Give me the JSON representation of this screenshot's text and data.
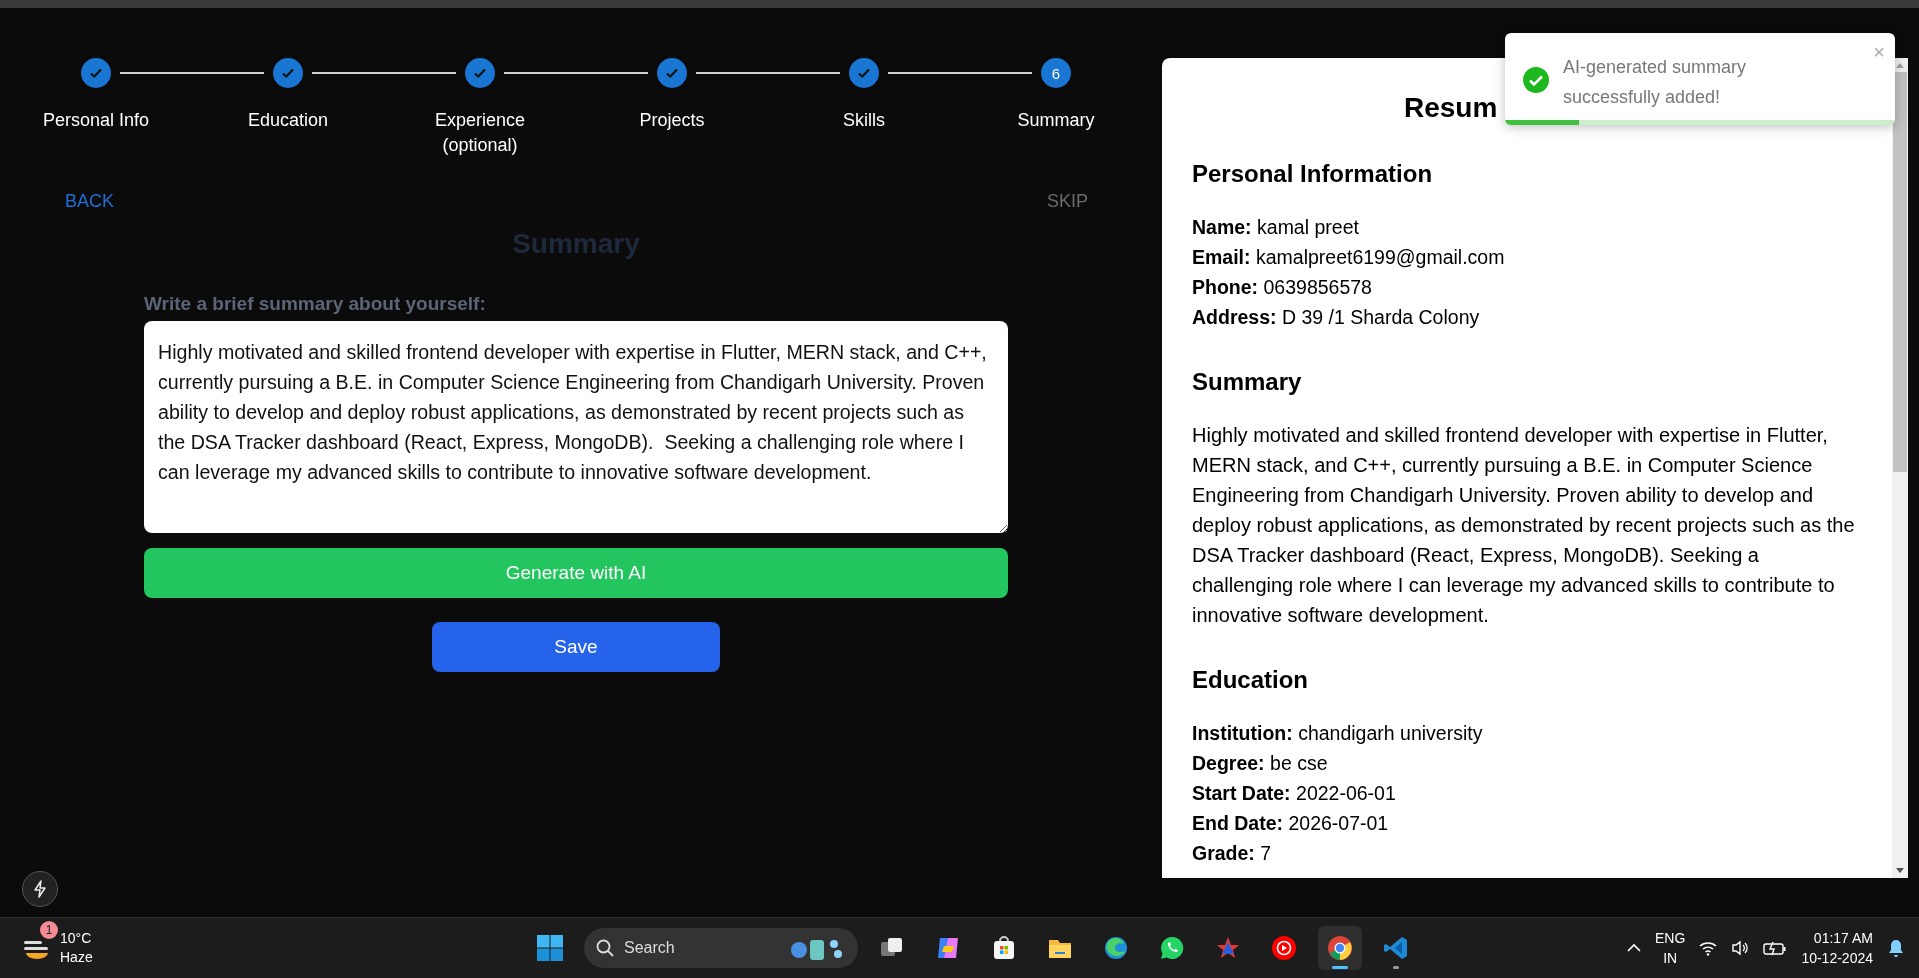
{
  "stepper": {
    "steps": [
      {
        "label": "Personal Info",
        "done": true
      },
      {
        "label": "Education",
        "done": true
      },
      {
        "label": "Experience (optional)",
        "done": true
      },
      {
        "label": "Projects",
        "done": true
      },
      {
        "label": "Skills",
        "done": true
      },
      {
        "label": "Summary",
        "done": false,
        "number": "6"
      }
    ]
  },
  "nav": {
    "back": "BACK",
    "skip": "SKIP"
  },
  "form": {
    "heading": "Summary",
    "label": "Write a brief summary about yourself:",
    "value": "Highly motivated and skilled frontend developer with expertise in Flutter, MERN stack, and C++, currently pursuing a B.E. in Computer Science Engineering from Chandigarh University. Proven ability to develop and deploy robust applications, as demonstrated by recent projects such as the DSA Tracker dashboard (React, Express, MongoDB).  Seeking a challenging role where I can leverage my advanced skills to contribute to innovative software development.",
    "generate_button": "Generate with AI",
    "save_button": "Save"
  },
  "resume": {
    "title": "Resum",
    "sections": [
      {
        "kind": "fields",
        "heading": "Personal Information",
        "rows": [
          {
            "label": "Name:",
            "value": "kamal preet"
          },
          {
            "label": "Email:",
            "value": "kamalpreet6199@gmail.com"
          },
          {
            "label": "Phone:",
            "value": "0639856578"
          },
          {
            "label": "Address:",
            "value": "D 39 /1 Sharda Colony"
          }
        ]
      },
      {
        "kind": "paragraph",
        "heading": "Summary",
        "text": "Highly motivated and skilled frontend developer with expertise in Flutter, MERN stack, and C++, currently pursuing a B.E. in Computer Science Engineering from Chandigarh University. Proven ability to develop and deploy robust applications, as demonstrated by recent projects such as the DSA Tracker dashboard (React, Express, MongoDB). Seeking a challenging role where I can leverage my advanced skills to contribute to innovative software development."
      },
      {
        "kind": "fields",
        "heading": "Education",
        "rows": [
          {
            "label": "Institution:",
            "value": "chandigarh university"
          },
          {
            "label": "Degree:",
            "value": "be cse"
          },
          {
            "label": "Start Date:",
            "value": "2022-06-01"
          },
          {
            "label": "End Date:",
            "value": "2026-07-01"
          },
          {
            "label": "Grade:",
            "value": "7"
          }
        ]
      }
    ]
  },
  "toast": {
    "message": "AI-generated summary successfully added!",
    "close": "×",
    "level": 0.19
  },
  "taskbar": {
    "weather": {
      "badge": "1",
      "temperature": "10°C",
      "condition": "Haze"
    },
    "search": {
      "placeholder": "Search"
    },
    "apps": [
      {
        "kind": "task-view",
        "selected": false,
        "running": false
      },
      {
        "kind": "copilot",
        "selected": false,
        "running": false
      },
      {
        "kind": "store",
        "selected": false,
        "running": false
      },
      {
        "kind": "folder",
        "selected": false,
        "running": false
      },
      {
        "kind": "edge",
        "selected": false,
        "running": false
      },
      {
        "kind": "chat",
        "selected": false,
        "running": false
      },
      {
        "kind": "star",
        "selected": false,
        "running": false
      },
      {
        "kind": "play",
        "selected": false,
        "running": false
      },
      {
        "kind": "chrome",
        "selected": true,
        "running": true
      },
      {
        "kind": "code",
        "selected": false,
        "running": true
      }
    ],
    "tray": {
      "language": "ENG",
      "region": "IN",
      "time": "01:17 AM",
      "date": "10-12-2024"
    }
  }
}
